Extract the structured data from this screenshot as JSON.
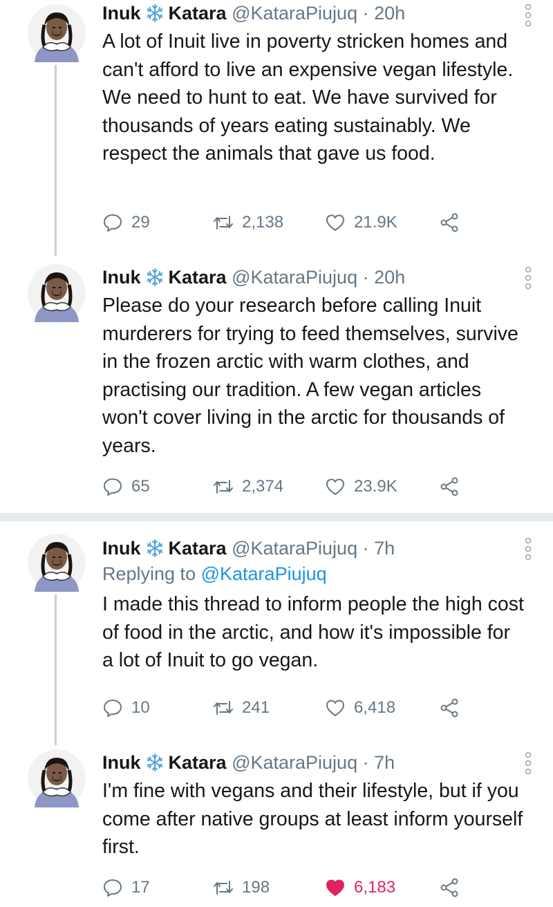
{
  "colors": {
    "accent": "#1b95e0",
    "like": "#e0245e",
    "secondary": "#657786",
    "separator": "#e6ecf0"
  },
  "tweets": [
    {
      "name_first": "Inuk",
      "name_last": "Katara",
      "handle": "@KataraPiujuq",
      "dot": "·",
      "time": "20h",
      "reply_prefix": "",
      "reply_to": "",
      "text": "A lot of Inuit live in poverty stricken homes and can't afford to live an expensive vegan lifestyle. We need to hunt to eat. We have survived for thousands of years eating sustainably. We respect the animals that gave us food.",
      "replies": "29",
      "retweets": "2,138",
      "likes": "21.9K",
      "liked": false
    },
    {
      "name_first": "Inuk",
      "name_last": "Katara",
      "handle": "@KataraPiujuq",
      "dot": "·",
      "time": "20h",
      "reply_prefix": "",
      "reply_to": "",
      "text": "Please do your research before calling Inuit murderers for trying to feed themselves, survive in the frozen arctic with warm clothes, and practising our tradition. A few vegan articles won't cover living in the arctic for thousands of years.",
      "replies": "65",
      "retweets": "2,374",
      "likes": "23.9K",
      "liked": false
    },
    {
      "name_first": "Inuk",
      "name_last": "Katara",
      "handle": "@KataraPiujuq",
      "dot": "·",
      "time": "7h",
      "reply_prefix": "Replying to",
      "reply_to": "@KataraPiujuq",
      "text": "I made this thread to inform people the high cost of food in the arctic, and how it's impossible for a lot of Inuit to go vegan.",
      "replies": "10",
      "retweets": "241",
      "likes": "6,418",
      "liked": false
    },
    {
      "name_first": "Inuk",
      "name_last": "Katara",
      "handle": "@KataraPiujuq",
      "dot": "·",
      "time": "7h",
      "reply_prefix": "",
      "reply_to": "",
      "text": "I'm fine with vegans and their lifestyle, but if you come after native groups at least inform yourself first.",
      "replies": "17",
      "retweets": "198",
      "likes": "6,183",
      "liked": true
    }
  ]
}
